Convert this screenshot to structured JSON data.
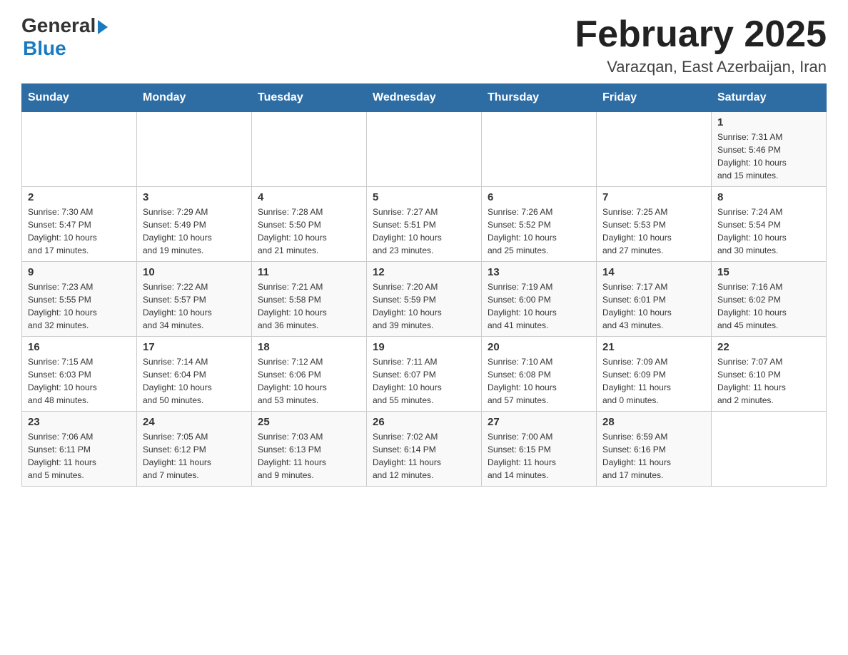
{
  "header": {
    "title": "February 2025",
    "location": "Varazqan, East Azerbaijan, Iran",
    "logo_general": "General",
    "logo_blue": "Blue"
  },
  "days_of_week": [
    "Sunday",
    "Monday",
    "Tuesday",
    "Wednesday",
    "Thursday",
    "Friday",
    "Saturday"
  ],
  "weeks": [
    [
      {
        "day": "",
        "info": ""
      },
      {
        "day": "",
        "info": ""
      },
      {
        "day": "",
        "info": ""
      },
      {
        "day": "",
        "info": ""
      },
      {
        "day": "",
        "info": ""
      },
      {
        "day": "",
        "info": ""
      },
      {
        "day": "1",
        "info": "Sunrise: 7:31 AM\nSunset: 5:46 PM\nDaylight: 10 hours\nand 15 minutes."
      }
    ],
    [
      {
        "day": "2",
        "info": "Sunrise: 7:30 AM\nSunset: 5:47 PM\nDaylight: 10 hours\nand 17 minutes."
      },
      {
        "day": "3",
        "info": "Sunrise: 7:29 AM\nSunset: 5:49 PM\nDaylight: 10 hours\nand 19 minutes."
      },
      {
        "day": "4",
        "info": "Sunrise: 7:28 AM\nSunset: 5:50 PM\nDaylight: 10 hours\nand 21 minutes."
      },
      {
        "day": "5",
        "info": "Sunrise: 7:27 AM\nSunset: 5:51 PM\nDaylight: 10 hours\nand 23 minutes."
      },
      {
        "day": "6",
        "info": "Sunrise: 7:26 AM\nSunset: 5:52 PM\nDaylight: 10 hours\nand 25 minutes."
      },
      {
        "day": "7",
        "info": "Sunrise: 7:25 AM\nSunset: 5:53 PM\nDaylight: 10 hours\nand 27 minutes."
      },
      {
        "day": "8",
        "info": "Sunrise: 7:24 AM\nSunset: 5:54 PM\nDaylight: 10 hours\nand 30 minutes."
      }
    ],
    [
      {
        "day": "9",
        "info": "Sunrise: 7:23 AM\nSunset: 5:55 PM\nDaylight: 10 hours\nand 32 minutes."
      },
      {
        "day": "10",
        "info": "Sunrise: 7:22 AM\nSunset: 5:57 PM\nDaylight: 10 hours\nand 34 minutes."
      },
      {
        "day": "11",
        "info": "Sunrise: 7:21 AM\nSunset: 5:58 PM\nDaylight: 10 hours\nand 36 minutes."
      },
      {
        "day": "12",
        "info": "Sunrise: 7:20 AM\nSunset: 5:59 PM\nDaylight: 10 hours\nand 39 minutes."
      },
      {
        "day": "13",
        "info": "Sunrise: 7:19 AM\nSunset: 6:00 PM\nDaylight: 10 hours\nand 41 minutes."
      },
      {
        "day": "14",
        "info": "Sunrise: 7:17 AM\nSunset: 6:01 PM\nDaylight: 10 hours\nand 43 minutes."
      },
      {
        "day": "15",
        "info": "Sunrise: 7:16 AM\nSunset: 6:02 PM\nDaylight: 10 hours\nand 45 minutes."
      }
    ],
    [
      {
        "day": "16",
        "info": "Sunrise: 7:15 AM\nSunset: 6:03 PM\nDaylight: 10 hours\nand 48 minutes."
      },
      {
        "day": "17",
        "info": "Sunrise: 7:14 AM\nSunset: 6:04 PM\nDaylight: 10 hours\nand 50 minutes."
      },
      {
        "day": "18",
        "info": "Sunrise: 7:12 AM\nSunset: 6:06 PM\nDaylight: 10 hours\nand 53 minutes."
      },
      {
        "day": "19",
        "info": "Sunrise: 7:11 AM\nSunset: 6:07 PM\nDaylight: 10 hours\nand 55 minutes."
      },
      {
        "day": "20",
        "info": "Sunrise: 7:10 AM\nSunset: 6:08 PM\nDaylight: 10 hours\nand 57 minutes."
      },
      {
        "day": "21",
        "info": "Sunrise: 7:09 AM\nSunset: 6:09 PM\nDaylight: 11 hours\nand 0 minutes."
      },
      {
        "day": "22",
        "info": "Sunrise: 7:07 AM\nSunset: 6:10 PM\nDaylight: 11 hours\nand 2 minutes."
      }
    ],
    [
      {
        "day": "23",
        "info": "Sunrise: 7:06 AM\nSunset: 6:11 PM\nDaylight: 11 hours\nand 5 minutes."
      },
      {
        "day": "24",
        "info": "Sunrise: 7:05 AM\nSunset: 6:12 PM\nDaylight: 11 hours\nand 7 minutes."
      },
      {
        "day": "25",
        "info": "Sunrise: 7:03 AM\nSunset: 6:13 PM\nDaylight: 11 hours\nand 9 minutes."
      },
      {
        "day": "26",
        "info": "Sunrise: 7:02 AM\nSunset: 6:14 PM\nDaylight: 11 hours\nand 12 minutes."
      },
      {
        "day": "27",
        "info": "Sunrise: 7:00 AM\nSunset: 6:15 PM\nDaylight: 11 hours\nand 14 minutes."
      },
      {
        "day": "28",
        "info": "Sunrise: 6:59 AM\nSunset: 6:16 PM\nDaylight: 11 hours\nand 17 minutes."
      },
      {
        "day": "",
        "info": ""
      }
    ]
  ]
}
